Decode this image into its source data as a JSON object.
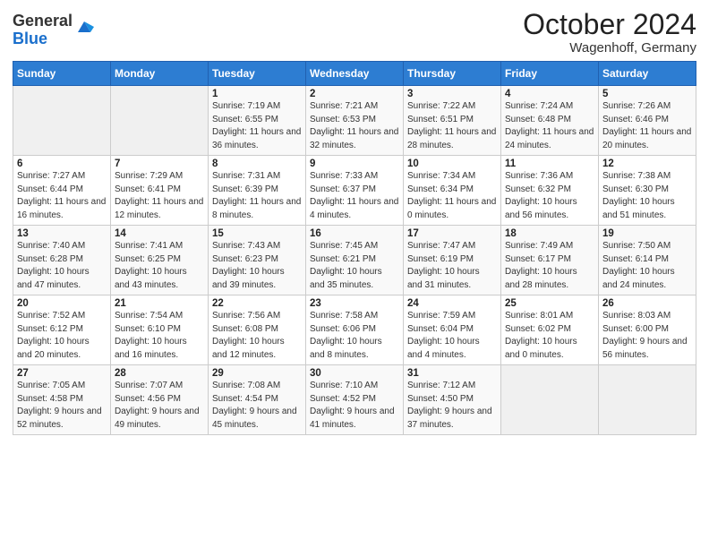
{
  "header": {
    "logo_general": "General",
    "logo_blue": "Blue",
    "month": "October 2024",
    "location": "Wagenhoff, Germany"
  },
  "weekdays": [
    "Sunday",
    "Monday",
    "Tuesday",
    "Wednesday",
    "Thursday",
    "Friday",
    "Saturday"
  ],
  "weeks": [
    [
      {
        "day": "",
        "info": ""
      },
      {
        "day": "",
        "info": ""
      },
      {
        "day": "1",
        "info": "Sunrise: 7:19 AM\nSunset: 6:55 PM\nDaylight: 11 hours and 36 minutes."
      },
      {
        "day": "2",
        "info": "Sunrise: 7:21 AM\nSunset: 6:53 PM\nDaylight: 11 hours and 32 minutes."
      },
      {
        "day": "3",
        "info": "Sunrise: 7:22 AM\nSunset: 6:51 PM\nDaylight: 11 hours and 28 minutes."
      },
      {
        "day": "4",
        "info": "Sunrise: 7:24 AM\nSunset: 6:48 PM\nDaylight: 11 hours and 24 minutes."
      },
      {
        "day": "5",
        "info": "Sunrise: 7:26 AM\nSunset: 6:46 PM\nDaylight: 11 hours and 20 minutes."
      }
    ],
    [
      {
        "day": "6",
        "info": "Sunrise: 7:27 AM\nSunset: 6:44 PM\nDaylight: 11 hours and 16 minutes."
      },
      {
        "day": "7",
        "info": "Sunrise: 7:29 AM\nSunset: 6:41 PM\nDaylight: 11 hours and 12 minutes."
      },
      {
        "day": "8",
        "info": "Sunrise: 7:31 AM\nSunset: 6:39 PM\nDaylight: 11 hours and 8 minutes."
      },
      {
        "day": "9",
        "info": "Sunrise: 7:33 AM\nSunset: 6:37 PM\nDaylight: 11 hours and 4 minutes."
      },
      {
        "day": "10",
        "info": "Sunrise: 7:34 AM\nSunset: 6:34 PM\nDaylight: 11 hours and 0 minutes."
      },
      {
        "day": "11",
        "info": "Sunrise: 7:36 AM\nSunset: 6:32 PM\nDaylight: 10 hours and 56 minutes."
      },
      {
        "day": "12",
        "info": "Sunrise: 7:38 AM\nSunset: 6:30 PM\nDaylight: 10 hours and 51 minutes."
      }
    ],
    [
      {
        "day": "13",
        "info": "Sunrise: 7:40 AM\nSunset: 6:28 PM\nDaylight: 10 hours and 47 minutes."
      },
      {
        "day": "14",
        "info": "Sunrise: 7:41 AM\nSunset: 6:25 PM\nDaylight: 10 hours and 43 minutes."
      },
      {
        "day": "15",
        "info": "Sunrise: 7:43 AM\nSunset: 6:23 PM\nDaylight: 10 hours and 39 minutes."
      },
      {
        "day": "16",
        "info": "Sunrise: 7:45 AM\nSunset: 6:21 PM\nDaylight: 10 hours and 35 minutes."
      },
      {
        "day": "17",
        "info": "Sunrise: 7:47 AM\nSunset: 6:19 PM\nDaylight: 10 hours and 31 minutes."
      },
      {
        "day": "18",
        "info": "Sunrise: 7:49 AM\nSunset: 6:17 PM\nDaylight: 10 hours and 28 minutes."
      },
      {
        "day": "19",
        "info": "Sunrise: 7:50 AM\nSunset: 6:14 PM\nDaylight: 10 hours and 24 minutes."
      }
    ],
    [
      {
        "day": "20",
        "info": "Sunrise: 7:52 AM\nSunset: 6:12 PM\nDaylight: 10 hours and 20 minutes."
      },
      {
        "day": "21",
        "info": "Sunrise: 7:54 AM\nSunset: 6:10 PM\nDaylight: 10 hours and 16 minutes."
      },
      {
        "day": "22",
        "info": "Sunrise: 7:56 AM\nSunset: 6:08 PM\nDaylight: 10 hours and 12 minutes."
      },
      {
        "day": "23",
        "info": "Sunrise: 7:58 AM\nSunset: 6:06 PM\nDaylight: 10 hours and 8 minutes."
      },
      {
        "day": "24",
        "info": "Sunrise: 7:59 AM\nSunset: 6:04 PM\nDaylight: 10 hours and 4 minutes."
      },
      {
        "day": "25",
        "info": "Sunrise: 8:01 AM\nSunset: 6:02 PM\nDaylight: 10 hours and 0 minutes."
      },
      {
        "day": "26",
        "info": "Sunrise: 8:03 AM\nSunset: 6:00 PM\nDaylight: 9 hours and 56 minutes."
      }
    ],
    [
      {
        "day": "27",
        "info": "Sunrise: 7:05 AM\nSunset: 4:58 PM\nDaylight: 9 hours and 52 minutes."
      },
      {
        "day": "28",
        "info": "Sunrise: 7:07 AM\nSunset: 4:56 PM\nDaylight: 9 hours and 49 minutes."
      },
      {
        "day": "29",
        "info": "Sunrise: 7:08 AM\nSunset: 4:54 PM\nDaylight: 9 hours and 45 minutes."
      },
      {
        "day": "30",
        "info": "Sunrise: 7:10 AM\nSunset: 4:52 PM\nDaylight: 9 hours and 41 minutes."
      },
      {
        "day": "31",
        "info": "Sunrise: 7:12 AM\nSunset: 4:50 PM\nDaylight: 9 hours and 37 minutes."
      },
      {
        "day": "",
        "info": ""
      },
      {
        "day": "",
        "info": ""
      }
    ]
  ]
}
